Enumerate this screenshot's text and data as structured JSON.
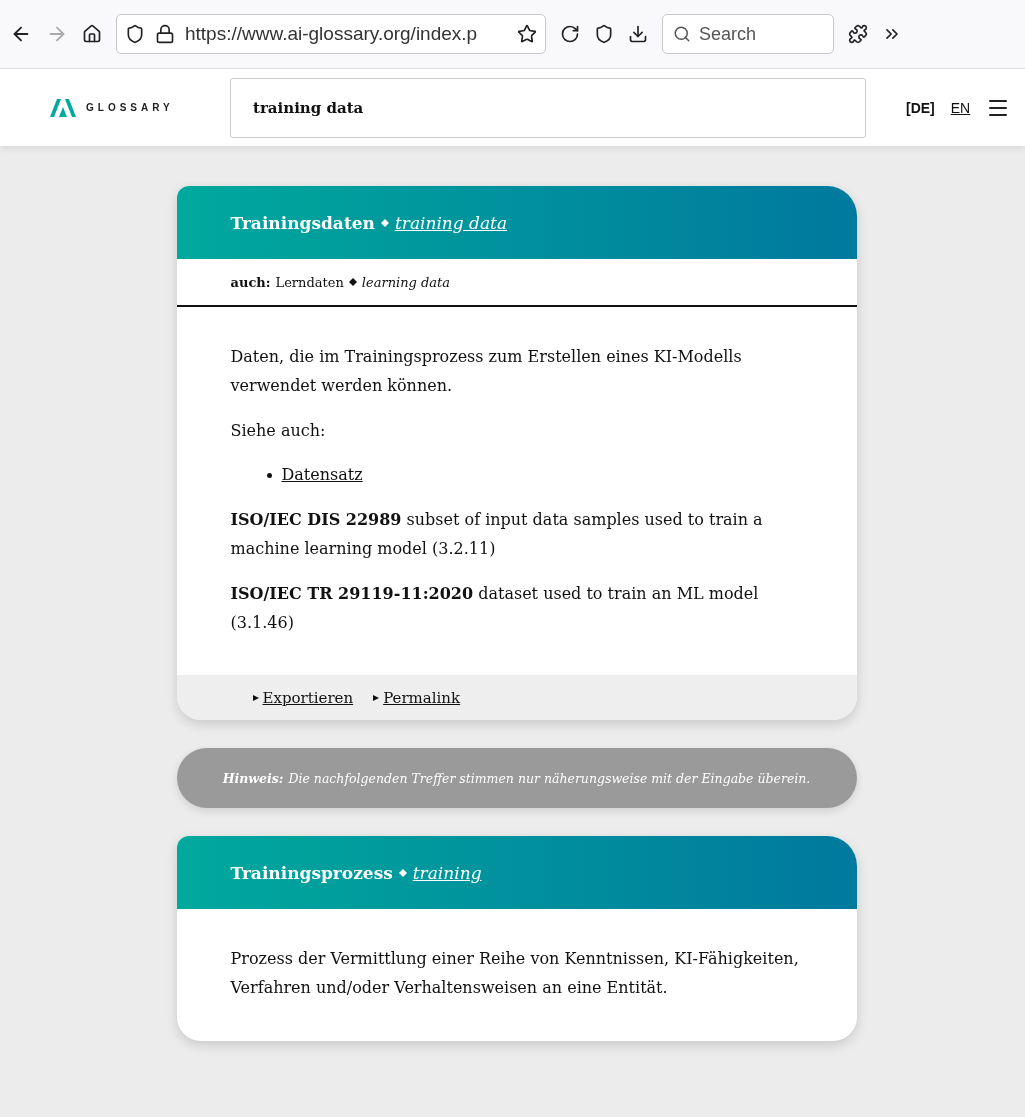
{
  "browser": {
    "url": "https://www.ai-glossary.org/index.p",
    "search_placeholder": "Search"
  },
  "site": {
    "logo_text": "GLOSSARY",
    "search_value": "training data",
    "languages": [
      {
        "label": "[DE]",
        "selected": true
      },
      {
        "label": "EN",
        "selected": false
      }
    ]
  },
  "entries": [
    {
      "kind": "entry",
      "term": "Trainingsdaten",
      "translation": "training data",
      "alias_label": "auch:",
      "alias": "Lerndaten",
      "alias_translation": "learning data",
      "paragraphs": [
        "Daten, die im Trainingsprozess zum Erstellen eines KI-Modells verwendet werden können.",
        "Siehe auch:"
      ],
      "see_also": [
        "Datensatz"
      ],
      "sources": [
        "**ISO/IEC DIS 22989** subset of input data samples used to train a machine learning model (3.2.11)",
        "**ISO/IEC TR 29119-11:2020** dataset used to train an ML model (3.1.46)"
      ],
      "actions": [
        "Exportieren",
        "Permalink"
      ]
    },
    {
      "kind": "notice",
      "label": "Hinweis:",
      "text": "Die nachfolgenden Treffer stimmen nur näherungsweise mit der Eingabe überein."
    },
    {
      "kind": "entry",
      "term": "Trainingsprozess",
      "translation": "training",
      "paragraphs": [
        "Prozess der Vermittlung einer Reihe von Kenntnissen, KI-Fähigkeiten, Verfahren und/oder Verhaltensweisen an eine Entität."
      ]
    }
  ]
}
